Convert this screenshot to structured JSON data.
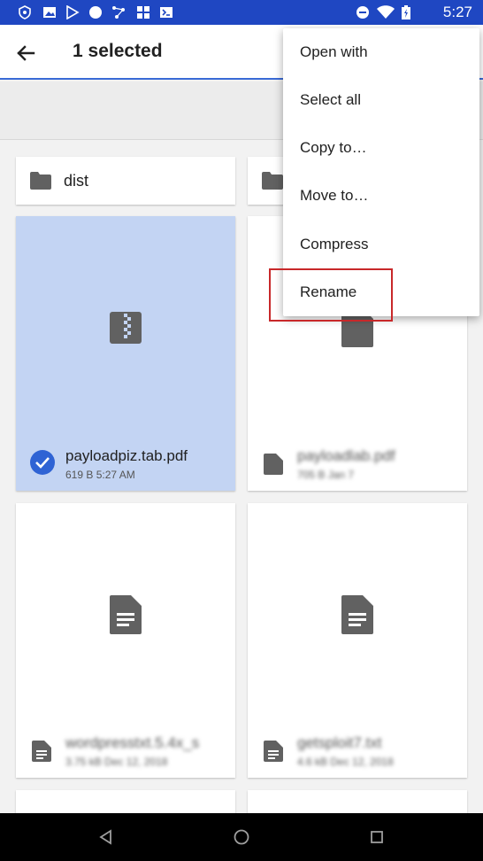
{
  "status_bar": {
    "time": "5:27",
    "left_icons": [
      "security-icon",
      "image-icon",
      "play-store-icon",
      "circle-app-icon",
      "connections-icon",
      "store-icon",
      "terminal-icon"
    ],
    "right_icons": [
      "do-not-disturb-icon",
      "wifi-icon",
      "battery-icon"
    ],
    "background": "#1f47c2"
  },
  "app_bar": {
    "title": "1 selected",
    "back_icon": "arrow-back-icon"
  },
  "folders": [
    {
      "name": "dist"
    },
    {
      "name": ""
    }
  ],
  "files": [
    {
      "name": "payloadpiz.tab.pdf",
      "meta": "619 B 5:27 AM",
      "selected": true,
      "icon": "zip-icon"
    },
    {
      "name": "payloadlab.pdf",
      "meta": "705 B Jan 7",
      "selected": false,
      "icon": "document-icon"
    },
    {
      "name": "wordpresstxt.5.4x_s",
      "meta": "3.75 kB Dec 12, 2018",
      "selected": false,
      "icon": "document-icon"
    },
    {
      "name": "getsploit7.txt",
      "meta": "4.6 kB Dec 12, 2018",
      "selected": false,
      "icon": "document-icon"
    }
  ],
  "menu": {
    "items": [
      "Open with",
      "Select all",
      "Copy to…",
      "Move to…",
      "Compress",
      "Rename"
    ],
    "highlighted": "Rename",
    "highlight_color": "#c8282a"
  },
  "colors": {
    "accent": "#3a6ad6",
    "selected_tile": "#c3d4f3",
    "check": "#2f63d4"
  },
  "nav_bar": {
    "buttons": [
      "back-triangle-icon",
      "home-circle-icon",
      "recents-square-icon"
    ]
  }
}
